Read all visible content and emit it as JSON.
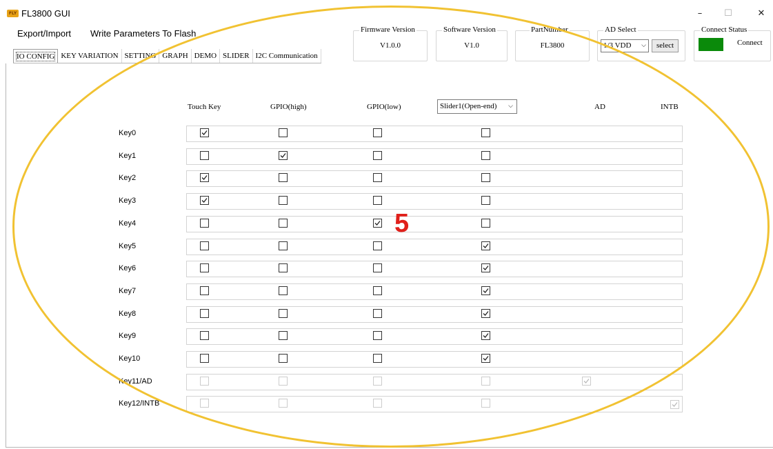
{
  "window": {
    "title": "FL3800 GUI",
    "icon_text": "FLY",
    "controls": [
      "–",
      "☐",
      "✕"
    ]
  },
  "menu": {
    "export_import": "Export/Import",
    "write_params": "Write Parameters To Flash"
  },
  "tabs": [
    {
      "label": "IO CONFIG",
      "active": true
    },
    {
      "label": "KEY VARIATION"
    },
    {
      "label": "SETTING"
    },
    {
      "label": "GRAPH"
    },
    {
      "label": "DEMO"
    },
    {
      "label": "SLIDER"
    },
    {
      "label": "I2C Communication"
    }
  ],
  "info": {
    "firmware_label": "Firmware Version",
    "firmware_value": "V1.0.0",
    "software_label": "Software Version",
    "software_value": "V1.0",
    "part_label": "PartNumber",
    "part_value": "FL3800",
    "ad_label": "AD Select",
    "ad_value": "1/3 VDD",
    "ad_button": "select",
    "connect_label": "Connect Status",
    "connect_value": "Connect",
    "connect_color": "#0a8a0a"
  },
  "table": {
    "headers": {
      "touch": "Touch Key",
      "gpio_high": "GPIO(high)",
      "gpio_low": "GPIO(low)",
      "slider": "Slider1(Open-end)",
      "ad": "AD",
      "intb": "INTB"
    },
    "rows": [
      {
        "label": "Key0",
        "touch": true,
        "high": false,
        "low": false,
        "slider": false,
        "disabled": false
      },
      {
        "label": "Key1",
        "touch": false,
        "high": true,
        "low": false,
        "slider": false,
        "disabled": false
      },
      {
        "label": "Key2",
        "touch": true,
        "high": false,
        "low": false,
        "slider": false,
        "disabled": false
      },
      {
        "label": "Key3",
        "touch": true,
        "high": false,
        "low": false,
        "slider": false,
        "disabled": false
      },
      {
        "label": "Key4",
        "touch": false,
        "high": false,
        "low": true,
        "slider": false,
        "disabled": false
      },
      {
        "label": "Key5",
        "touch": false,
        "high": false,
        "low": false,
        "slider": true,
        "disabled": false
      },
      {
        "label": "Key6",
        "touch": false,
        "high": false,
        "low": false,
        "slider": true,
        "disabled": false
      },
      {
        "label": "Key7",
        "touch": false,
        "high": false,
        "low": false,
        "slider": true,
        "disabled": false
      },
      {
        "label": "Key8",
        "touch": false,
        "high": false,
        "low": false,
        "slider": true,
        "disabled": false
      },
      {
        "label": "Key9",
        "touch": false,
        "high": false,
        "low": false,
        "slider": true,
        "disabled": false
      },
      {
        "label": "Key10",
        "touch": false,
        "high": false,
        "low": false,
        "slider": true,
        "disabled": false
      },
      {
        "label": "Key11/AD",
        "touch": false,
        "high": false,
        "low": false,
        "slider": false,
        "disabled": true,
        "ad": true
      },
      {
        "label": "Key12/INTB",
        "touch": false,
        "high": false,
        "low": false,
        "slider": false,
        "disabled": true,
        "intb": true
      }
    ]
  },
  "annotation": {
    "number": "5",
    "color": "#e0201b",
    "ring_color": "#f1c232"
  }
}
